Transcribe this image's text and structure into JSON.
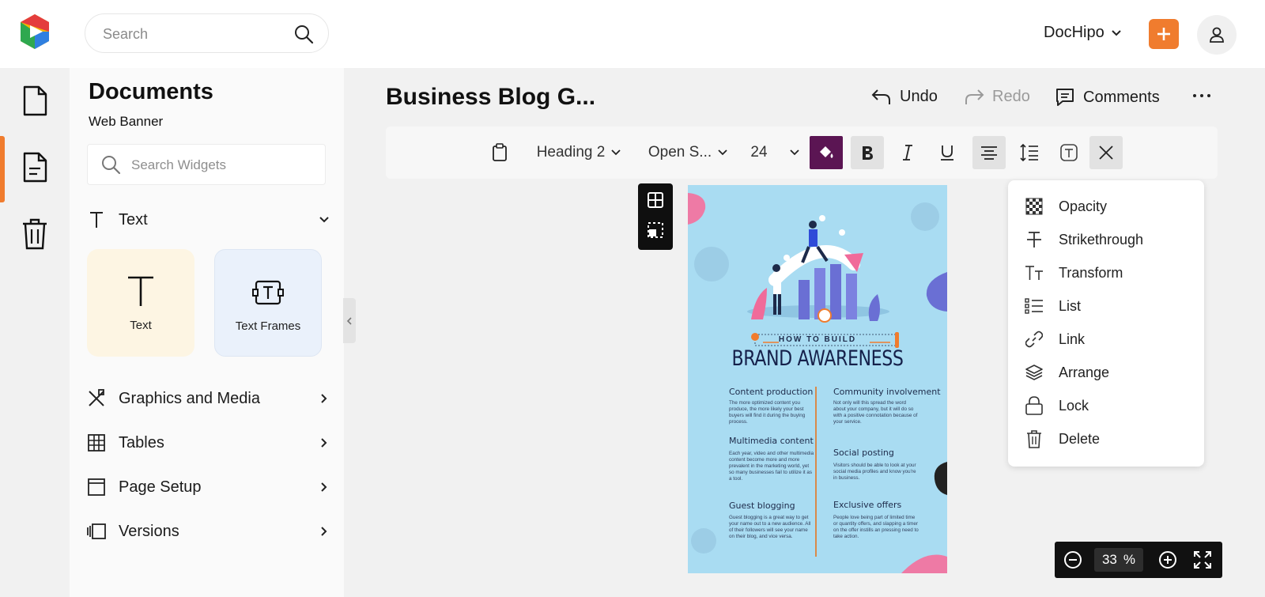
{
  "topbar": {
    "search_placeholder": "Search",
    "workspace": "DocHipo",
    "accent": "#f07c2e"
  },
  "panel": {
    "title": "Documents",
    "subtitle": "Web Banner",
    "widget_search_placeholder": "Search Widgets",
    "sections": {
      "text": "Text",
      "graphics": "Graphics and Media",
      "tables": "Tables",
      "page_setup": "Page Setup",
      "versions": "Versions"
    },
    "cards": [
      {
        "label": "Text",
        "bg": "#fdf5e3"
      },
      {
        "label": "Text Frames",
        "bg": "#eaf1fb"
      }
    ]
  },
  "editor": {
    "doc_title": "Business Blog G...",
    "undo": "Undo",
    "redo": "Redo",
    "comments": "Comments"
  },
  "toolbar": {
    "heading": "Heading 2",
    "font": "Open S...",
    "size": "24",
    "color_swatch": "#5b1553"
  },
  "menu": {
    "items": [
      "Opacity",
      "Strikethrough",
      "Transform",
      "List",
      "Link",
      "Arrange",
      "Lock",
      "Delete"
    ]
  },
  "document": {
    "kicker": "HOW TO BUILD",
    "headline": "BRAND AWARENESS",
    "sections": [
      {
        "title": "Content production",
        "body": "The more optimized content you produce, the more likely your best buyers will find it during the buying process."
      },
      {
        "title": "Community involvement",
        "body": "Not only will this spread the word about your company, but it will do so with a positive connotation because of your service."
      },
      {
        "title": "Multimedia content",
        "body": "Each year, video and other multimedia content become more and more prevalent in the marketing world, yet so many businesses fail to utilize it as a tool."
      },
      {
        "title": "Social posting",
        "body": "Visitors should be able to look at your social media profiles and know you're in business."
      },
      {
        "title": "Guest blogging",
        "body": "Guest blogging is a great way to get your name out to a new audience. All of their followers will see your name on their blog, and vice versa."
      },
      {
        "title": "Exclusive offers",
        "body": "People love being part of limited time or quantity offers, and slapping a timer on the offer instills an pressing need to take action."
      }
    ]
  },
  "zoom": {
    "value": "33",
    "unit": "%"
  }
}
